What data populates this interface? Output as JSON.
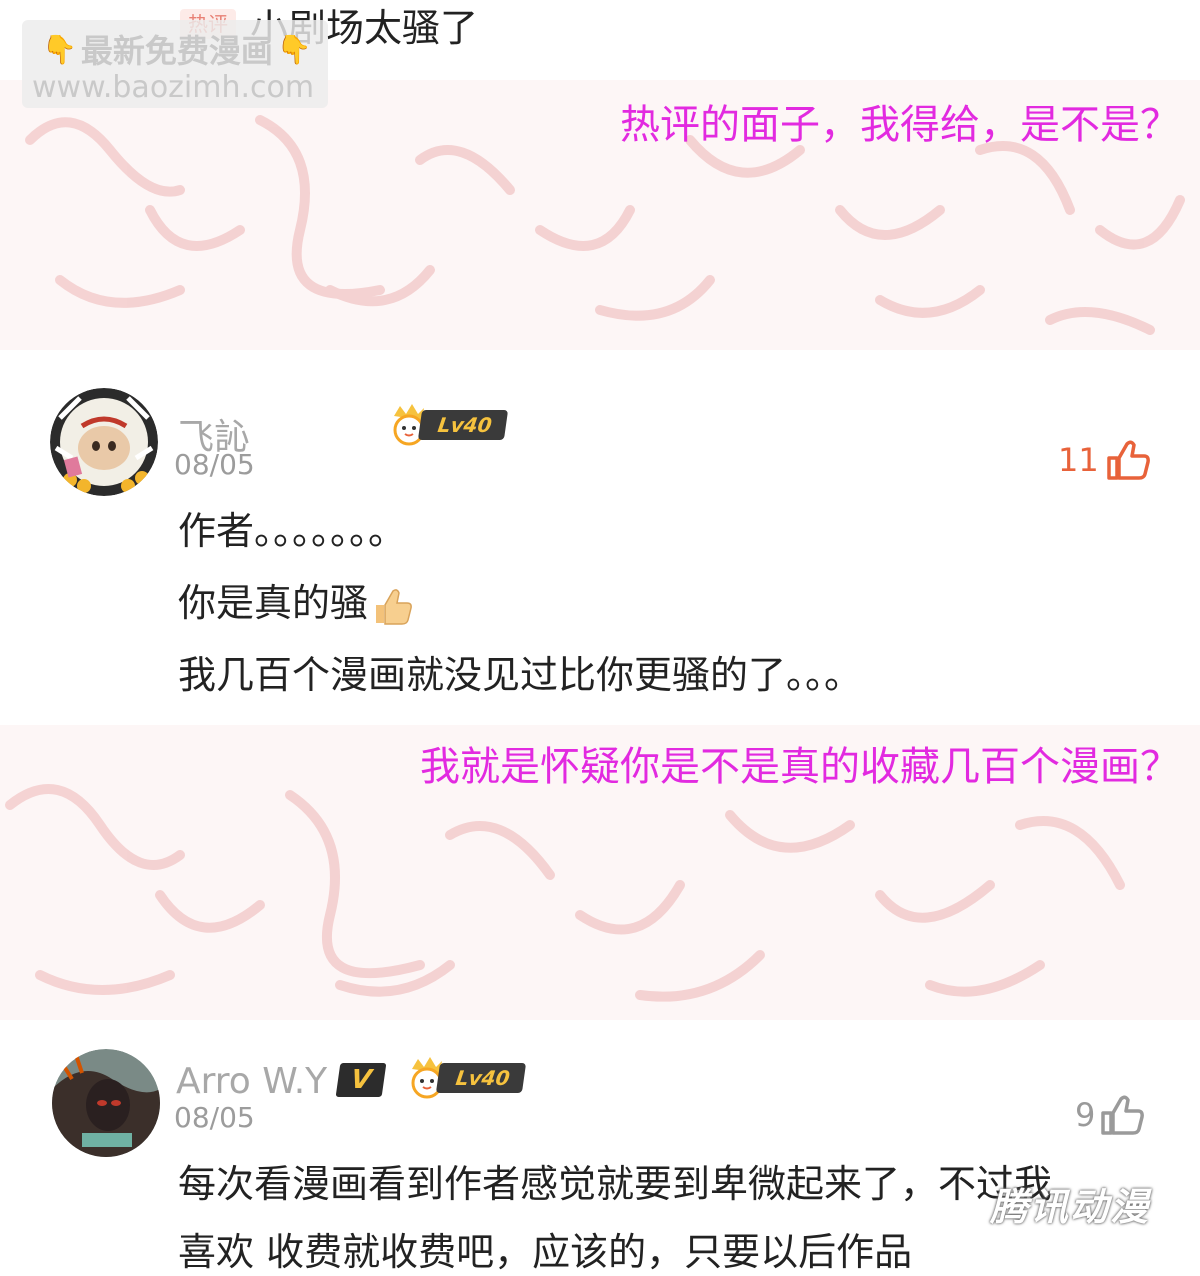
{
  "top_comment": {
    "hot_tag": "热评",
    "text": "小剧场太骚了"
  },
  "watermark": {
    "line1": "最新免费漫画",
    "line2": "www.baozimh.com"
  },
  "notes": {
    "first": "热评的面子，我得给，是不是？",
    "second": "我就是怀疑你是不是真的收藏几百个漫画？"
  },
  "comment1": {
    "username": "飞訫",
    "date": "08/05",
    "level": "Lv40",
    "likes": "11",
    "lines": [
      "作者。。。。。。。",
      "你是真的骚",
      "我几百个漫画就没见过比你更骚的了。。。"
    ]
  },
  "comment2": {
    "username": "Arro W.Y",
    "vip": "V",
    "date": "08/05",
    "level": "Lv40",
    "likes": "9",
    "lines": [
      "每次看漫画看到作者感觉就要到卑微起来了，不过我",
      "喜欢  收费就收费吧，应该的，只要以后作品"
    ]
  },
  "corner_logo": "腾讯动漫",
  "colors": {
    "note": "#e22ae0",
    "like_active": "#e8623a",
    "like_inactive": "#9a9a9a",
    "level_badge": "#3a3a3a"
  }
}
